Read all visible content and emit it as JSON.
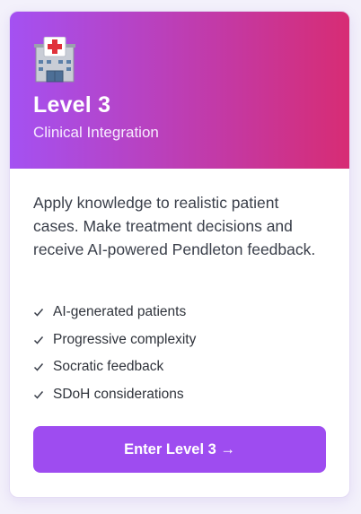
{
  "card": {
    "icon": "hospital-icon",
    "title": "Level 3",
    "subtitle": "Clinical Integration",
    "description": "Apply knowledge to realistic patient cases. Make treatment decisions and receive AI-powered Pendleton feedback.",
    "features": [
      "AI-generated patients",
      "Progressive complexity",
      "Socratic feedback",
      "SDoH considerations"
    ],
    "button_label": "Enter Level 3 →"
  },
  "colors": {
    "header_gradient_start": "#a451f2",
    "header_gradient_end": "#d72c74",
    "button": "#9e4cf0",
    "text": "#3a3f4a"
  }
}
